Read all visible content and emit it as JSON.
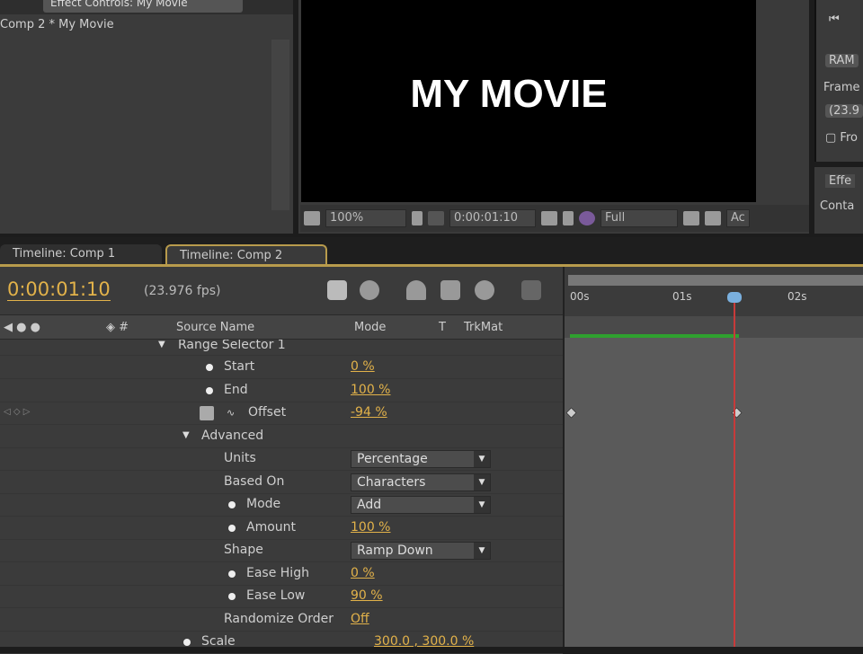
{
  "effect_controls": {
    "tab_label": "Effect Controls: My Movie",
    "subtitle": "Comp 2 * My Movie"
  },
  "viewer": {
    "title_text": "MY MOVIE",
    "zoom": "100%",
    "timecode": "0:00:01:10",
    "resolution": "Full",
    "extra": "Ac"
  },
  "right_panel": {
    "ram_label": "RAM",
    "frame_label": "Frame",
    "frame_value": "(23.9",
    "from_label": "Fro",
    "effects_tab": "Effe",
    "contents_label": "Conta"
  },
  "tabs": [
    {
      "label": "Timeline: Comp 1"
    },
    {
      "label": "Timeline: Comp 2"
    }
  ],
  "timeline": {
    "current_time": "0:00:01:10",
    "fps": "(23.976 fps)",
    "columns": {
      "source_name": "Source Name",
      "mode": "Mode",
      "t": "T",
      "trkmat": "TrkMat"
    },
    "ruler": [
      "00s",
      "01s",
      "02s"
    ],
    "rows": [
      {
        "label": "Range Selector 1"
      },
      {
        "label": "Start",
        "value": "0 %"
      },
      {
        "label": "End",
        "value": "100 %"
      },
      {
        "label": "Offset",
        "value": "-94 %"
      },
      {
        "label": "Advanced"
      },
      {
        "label": "Units",
        "dropdown": "Percentage"
      },
      {
        "label": "Based On",
        "dropdown": "Characters"
      },
      {
        "label": "Mode",
        "dropdown": "Add"
      },
      {
        "label": "Amount",
        "value": "100 %"
      },
      {
        "label": "Shape",
        "dropdown": "Ramp Down"
      },
      {
        "label": "Ease High",
        "value": "0 %"
      },
      {
        "label": "Ease Low",
        "value": "90 %"
      },
      {
        "label": "Randomize Order",
        "value": "Off"
      },
      {
        "label": "Scale",
        "value": "300.0 , 300.0 %"
      }
    ]
  }
}
